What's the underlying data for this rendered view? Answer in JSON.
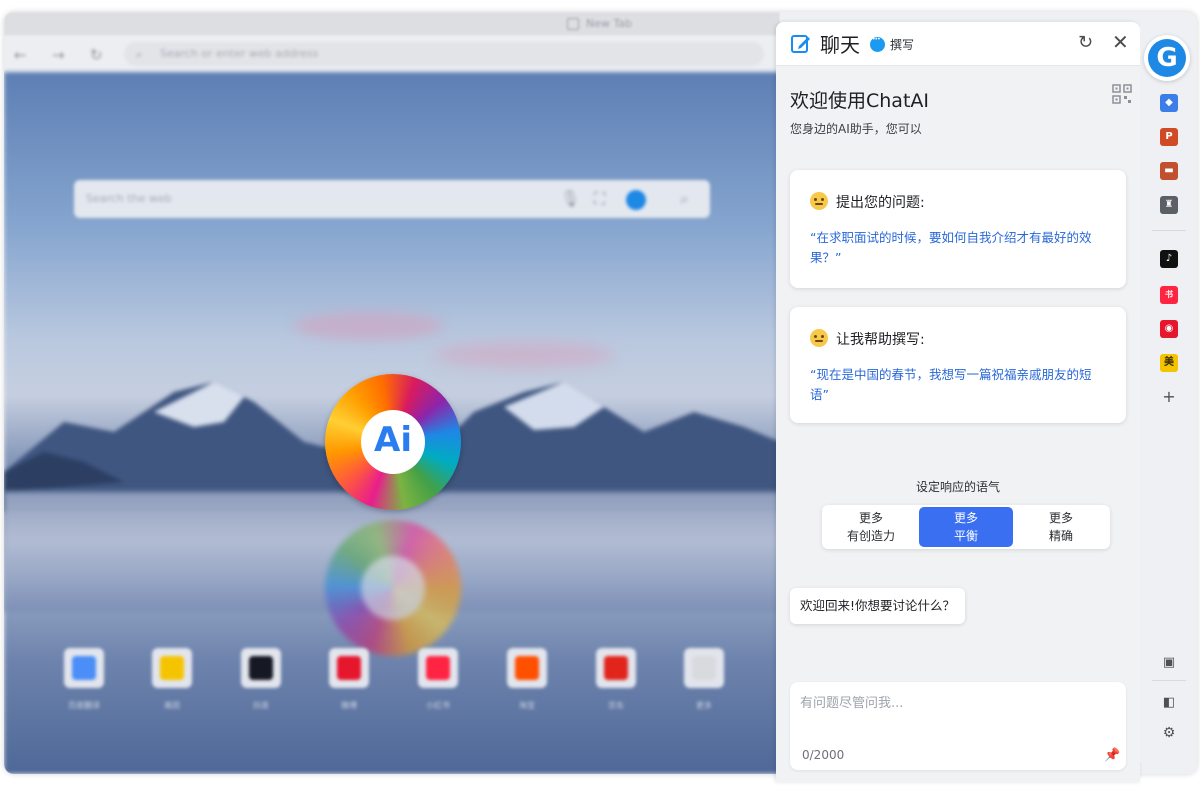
{
  "browser": {
    "tab_title": "New Tab",
    "address_placeholder": "Search or enter web address",
    "search_placeholder": "Search the web",
    "shortcuts": [
      {
        "label": "百度翻译",
        "color": "#4c8ef7"
      },
      {
        "label": "美团",
        "color": "#f5c400"
      },
      {
        "label": "抖音",
        "color": "#161823"
      },
      {
        "label": "微博",
        "color": "#e6162d"
      },
      {
        "label": "小红书",
        "color": "#ff2442"
      },
      {
        "label": "淘宝",
        "color": "#ff5000"
      },
      {
        "label": "京东",
        "color": "#e1251b"
      },
      {
        "label": "更多",
        "color": "#d8dade"
      }
    ],
    "ai_logo_text": "Ai"
  },
  "panel": {
    "tab_chat": "聊天",
    "tab_compose": "撰写",
    "welcome_title": "欢迎使用ChatAI",
    "welcome_sub": "您身边的AI助手，您可以",
    "cards": [
      {
        "title": "提出您的问题:",
        "text": "“在求职面试的时候，要如何自我介绍才有最好的效果？”"
      },
      {
        "title": "让我帮助撰写:",
        "text": "“现在是中国的春节，我想写一篇祝福亲戚朋友的短语”"
      }
    ],
    "tone_label": "设定响应的语气",
    "tones": [
      {
        "line1": "更多",
        "line2": "有创造力"
      },
      {
        "line1": "更多",
        "line2": "平衡"
      },
      {
        "line1": "更多",
        "line2": "精确"
      }
    ],
    "active_tone": 1,
    "greeting": "欢迎回来!你想要讨论什么？",
    "input_placeholder": "有问题尽管问我...",
    "counter": "0/2000"
  },
  "sidebar": {
    "logo_letter": "G",
    "apps": [
      {
        "name": "tag",
        "color": "#3d7de8",
        "glyph": "◆"
      },
      {
        "name": "powerpoint",
        "color": "#d04a26",
        "glyph": "P"
      },
      {
        "name": "toolbox",
        "color": "#c1502e",
        "glyph": "▬"
      },
      {
        "name": "chess",
        "color": "#5b5f66",
        "glyph": "♜"
      },
      {
        "name": "tiktok",
        "color": "#111111",
        "glyph": "♪"
      },
      {
        "name": "xiaohongshu",
        "color": "#ff2442",
        "glyph": "书"
      },
      {
        "name": "weibo",
        "color": "#e6162d",
        "glyph": "◉"
      },
      {
        "name": "meituan",
        "color": "#f5c400",
        "glyph": "美"
      }
    ]
  },
  "colors": {
    "accent": "#3b6ff2",
    "link_text": "#2a68d8"
  }
}
